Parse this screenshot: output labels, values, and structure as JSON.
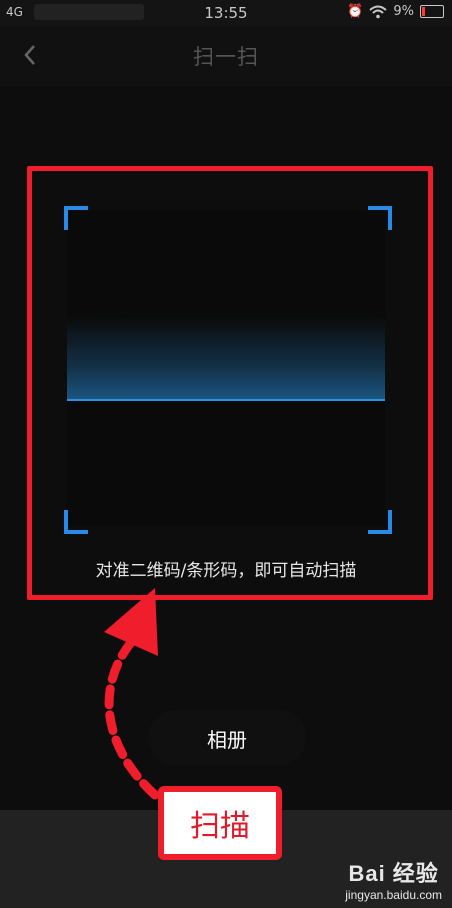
{
  "status_bar": {
    "carrier": "4G",
    "time": "13:55",
    "battery": "9%",
    "battery_color": "#ff3b30"
  },
  "nav": {
    "title": "扫一扫",
    "back_icon": "chevron-left-icon"
  },
  "scanner": {
    "hint": "对准二维码/条形码，即可自动扫描",
    "corner_color": "#2a8be6",
    "scan_line_color": "#2f8fe0"
  },
  "album_button": {
    "label": "相册"
  },
  "annotation": {
    "label": "扫描",
    "color": "#f01e2c"
  },
  "watermark": {
    "logo": "Bai 经验",
    "url": "jingyan.baidu.com"
  }
}
